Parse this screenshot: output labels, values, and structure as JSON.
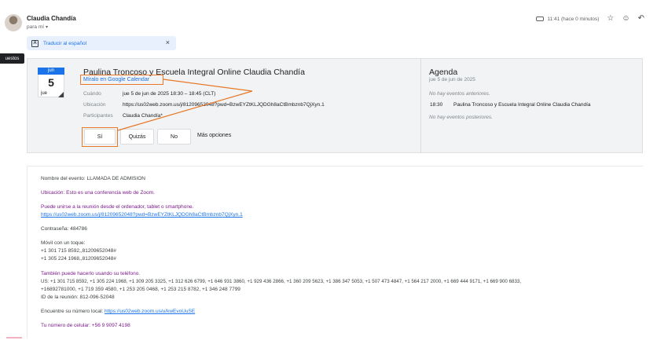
{
  "header": {
    "sender_name": "Claudia Chandía",
    "to_me": "para mí",
    "time": "11:41 (hace 0 minutos)"
  },
  "translate": {
    "label": "Traducir al español",
    "close": "×"
  },
  "side_tab": {
    "label": "uestos"
  },
  "invite": {
    "month": "jun",
    "day": "5",
    "weekday": "jue",
    "title": "Paulina Troncoso y Escuela Integral Online Claudia Chandía",
    "gcal_link": "Míralo en Google Calendar",
    "when_label": "Cuándo",
    "when_value": "jue 5 de jun de 2025 18:30 – 18:45 (CLT)",
    "where_label": "Ubicación",
    "where_value": "https://us02web.zoom.us/j/81209652048?pwd=BzwEYZtKLJQDGh8aCtBmbznb7QjXyn.1",
    "participants_label": "Participantes",
    "participants_value": "Claudia Chandía*",
    "rsvp": {
      "yes": "Sí",
      "maybe": "Quizás",
      "no": "No",
      "more": "Más opciones"
    }
  },
  "agenda": {
    "title": "Agenda",
    "date": "jue 5 de jun de 2025",
    "no_prev": "No hay eventos anteriores.",
    "time": "18:30",
    "event": "Paulina Troncoso y Escuela Integral Online Claudia Chandía",
    "no_next": "No hay eventos posteriores."
  },
  "body": {
    "event_name": "Nombre del evento: LLAMADA DE ADMISION",
    "location_note": "Ubicación: Esto es una conferencia web de Zoom.",
    "join_note": "Puede unirse a la reunión desde el ordenador, tablet o smartphone.",
    "join_link": "https://us02web.zoom.us/j/81209652048?pwd=BzwEYZtKLJQDGh8aCtBmbznb7QjXyn.1",
    "password": "Contraseña: 484786",
    "mobile_title": "Móvil con un toque:",
    "mobile_1": "+1 301 715 8592,,81209652048#",
    "mobile_2": "+1 305 224 1968,,81209652048#",
    "phone_title": "También puede hacerlo usando su teléfono.",
    "phone_line_1": "US: +1 301 715 8592, +1 305 224 1968, +1 309 205 3325, +1 312 626 6799, +1 646 931 3860, +1 929 436 2866, +1 360 209 5623, +1 386 347 5053, +1 507 473 4847, +1 564 217 2000, +1 669 444 9171, +1 669 900 6833,",
    "phone_line_2": "+16892781000, +1 719 359 4580, +1 253 205 0468, +1 253 215 8782, +1 346 248 7799",
    "meeting_id": "ID de la reunión: 812-096-52048",
    "local_label": "Encuentre su número local: ",
    "local_link": "https://us02web.zoom.us/u/kwEvoUuSE",
    "cell": "Tu número de celular: +56 9 9097 4198"
  },
  "colors": {
    "accent": "#1a73e8",
    "annotation": "#e8782a",
    "purple_text": "#7b1a8a"
  }
}
